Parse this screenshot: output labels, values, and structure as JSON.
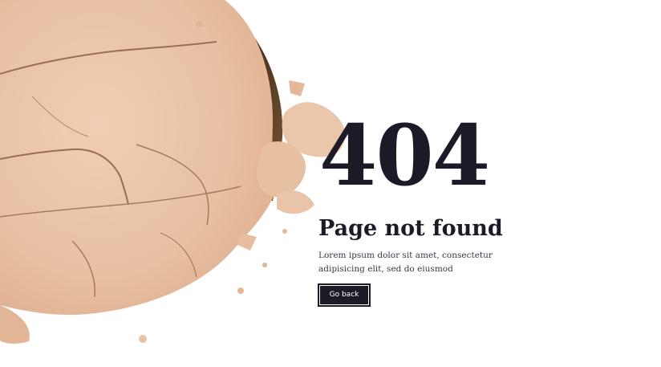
{
  "error": {
    "code": "404",
    "title": "Page not found",
    "description": "Lorem ipsum dolor sit amet, consectetur adipisicing elit, sed do eiusmod",
    "button_label": "Go back"
  },
  "colors": {
    "text_dark": "#1d1a27",
    "powder": "#e9c3a6",
    "background": "#ffffff"
  }
}
